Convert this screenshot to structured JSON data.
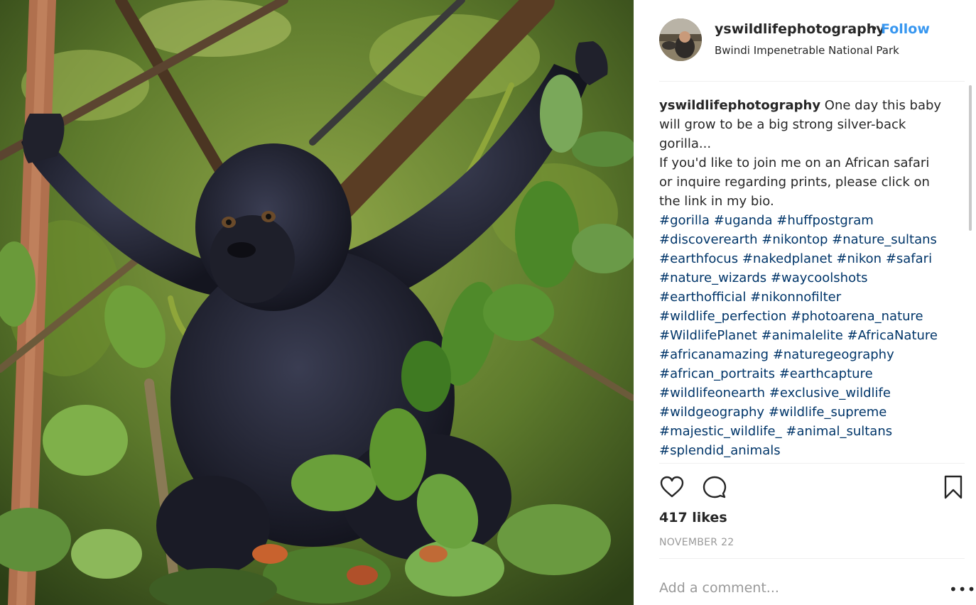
{
  "post": {
    "username": "yswildlifephotography",
    "dot": "•",
    "follow_label": "Follow",
    "location": "Bwindi Impenetrable National Park",
    "caption_user": "yswildlifephotography",
    "caption_lines": [
      " One day this baby",
      "will grow to be a big strong silver-back",
      "gorilla...",
      "If you'd like to join me on an African safari",
      "or inquire regarding prints, please click on",
      "the link in my bio."
    ],
    "hashtag_lines": [
      [
        "#gorilla",
        "#uganda",
        "#huffpostgram"
      ],
      [
        "#discoverearth",
        "#nikontop",
        "#nature_sultans"
      ],
      [
        "#earthfocus",
        "#nakedplanet",
        "#nikon",
        "#safari"
      ],
      [
        "#nature_wizards",
        "#waycoolshots"
      ],
      [
        "#earthofficial",
        "#nikonnofilter"
      ],
      [
        "#wildlife_perfection",
        "#photoarena_nature"
      ],
      [
        "#WildlifePlanet",
        "#animalelite",
        "#AfricaNature"
      ],
      [
        "#africanamazing",
        "#naturegeography"
      ],
      [
        "#african_portraits",
        "#earthcapture"
      ],
      [
        "#wildlifeonearth",
        "#exclusive_wildlife"
      ],
      [
        "#wildgeography",
        "#wildlife_supreme"
      ],
      [
        "#majestic_wildlife_",
        "#animal_sultans"
      ],
      [
        "#splendid_animals"
      ]
    ],
    "likes": "417 likes",
    "date": "NOVEMBER 22",
    "comment_placeholder": "Add a comment...",
    "more_label": "•••",
    "icons": {
      "like": "heart-icon",
      "comment": "comment-icon",
      "save": "bookmark-icon"
    },
    "colors": {
      "follow": "#3897f0",
      "hashtag": "#003569",
      "text": "#262626",
      "muted": "#999999"
    }
  }
}
